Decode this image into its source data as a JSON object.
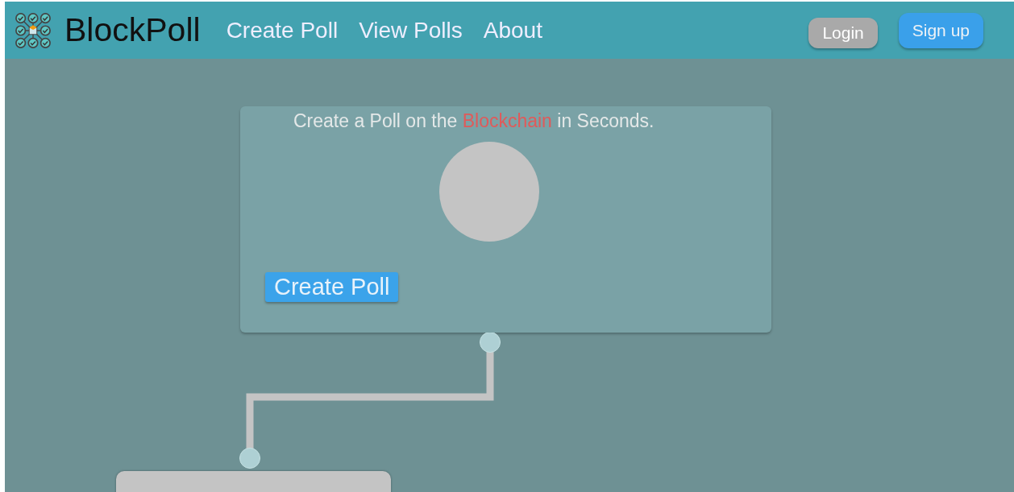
{
  "header": {
    "brand": "BlockPoll",
    "nav": [
      {
        "label": "Create Poll"
      },
      {
        "label": "View Polls"
      },
      {
        "label": "About"
      }
    ],
    "auth": [
      {
        "label": "Login",
        "kind": "secondary"
      },
      {
        "label": "Sign up",
        "kind": "primary"
      }
    ]
  },
  "hero": {
    "headline": [
      {
        "text": "Create a Poll on the ",
        "highlight": false
      },
      {
        "text": "Blockchain",
        "highlight": true
      },
      {
        "text": " in Seconds.",
        "highlight": false
      }
    ],
    "button": "Create Poll"
  }
}
